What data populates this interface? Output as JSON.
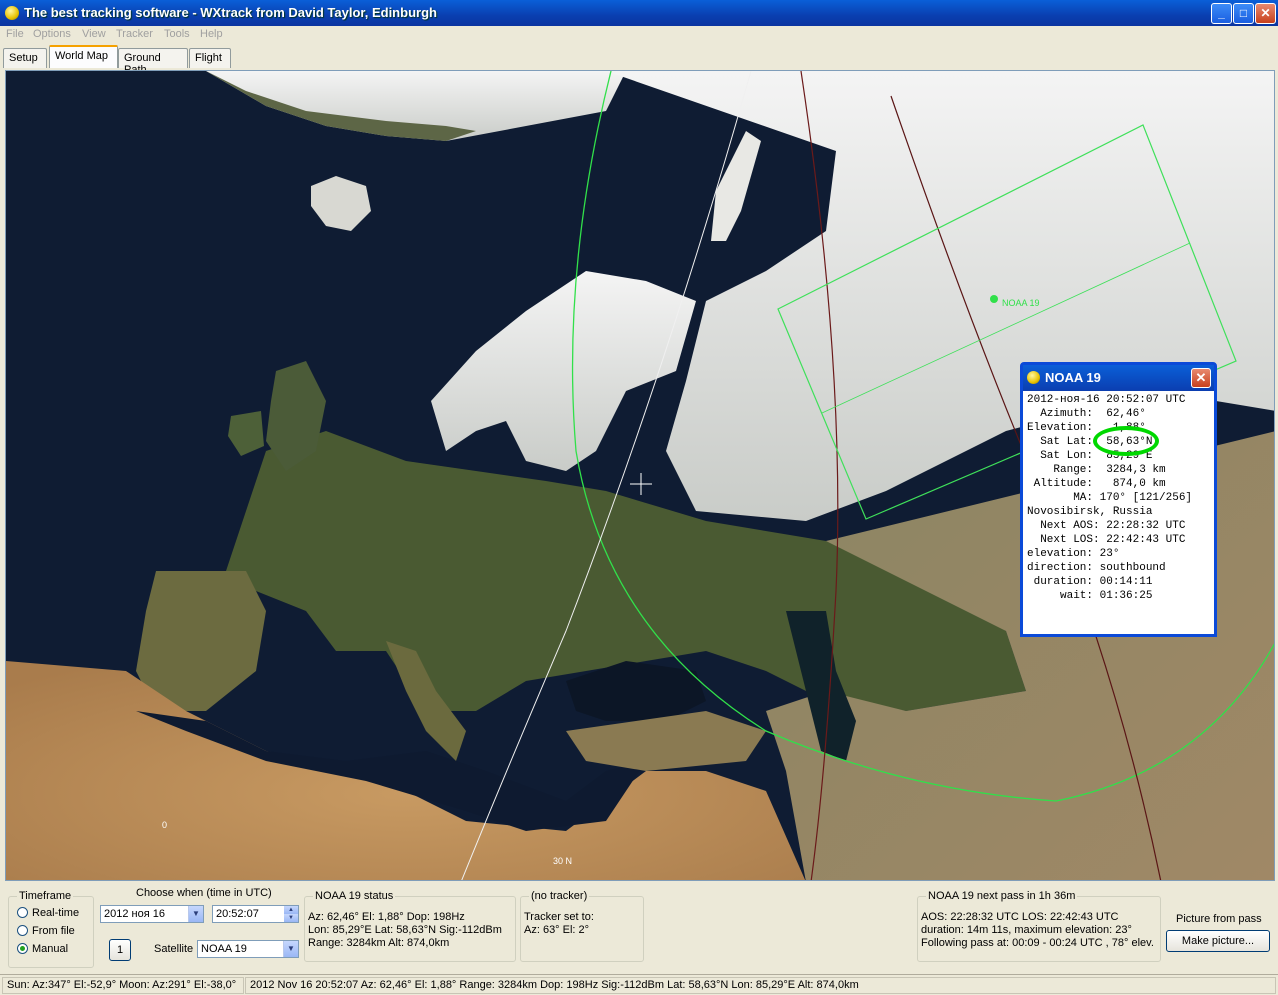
{
  "window": {
    "title": "The best tracking software - WXtrack from David Taylor, Edinburgh"
  },
  "menu": [
    "File",
    "Options",
    "View",
    "Tracker",
    "Tools",
    "Help"
  ],
  "tabs": [
    "Setup",
    "World Map",
    "Ground Path",
    "Flight"
  ],
  "map": {
    "labels": {
      "lat30": "30 N",
      "lon0": "0"
    },
    "sat_label": "NOAA 19"
  },
  "popup": {
    "title": "NOAA 19",
    "lines": [
      "2012-ноя-16 20:52:07 UTC",
      "",
      "  Azimuth:  62,46°",
      "Elevation:   1,88°",
      "  Sat Lat:  58,63°N",
      "  Sat Lon:  85,29°E",
      "    Range:  3284,3 km",
      " Altitude:   874,0 km",
      "       MA: 170° [121/256]",
      "Novosibirsk, Russia",
      "",
      "  Next AOS: 22:28:32 UTC",
      "  Next LOS: 22:42:43 UTC",
      "elevation: 23°",
      "direction: southbound",
      " duration: 00:14:11",
      "     wait: 01:36:25"
    ]
  },
  "timeframe": {
    "label": "Timeframe",
    "options": [
      "Real-time",
      "From file",
      "Manual"
    ],
    "selected": "Manual"
  },
  "choose": {
    "label": "Choose when (time in UTC)",
    "date": "2012 ноя 16",
    "time": "20:52:07",
    "step": "1",
    "satellite_label": "Satellite",
    "satellite": "NOAA 19"
  },
  "status": {
    "label": "NOAA 19 status",
    "line1": "Az: 62,46°  El: 1,88°  Dop: 198Hz",
    "line2": "Lon: 85,29°E  Lat: 58,63°N  Sig:-112dBm",
    "line3": "Range: 3284km  Alt: 874,0km"
  },
  "tracker": {
    "label": "(no tracker)",
    "line1": "Tracker set to:",
    "line2": "Az: 63°  El: 2°"
  },
  "nextpass": {
    "label": "NOAA 19 next pass in 1h 36m",
    "line1": "AOS: 22:28:32 UTC  LOS: 22:42:43 UTC",
    "line2": "duration: 14m 11s,  maximum elevation: 23°",
    "line3": "Following pass at: 00:09 - 00:24 UTC , 78° elev."
  },
  "picture": {
    "label": "Picture from pass",
    "button": "Make picture..."
  },
  "statusbar": {
    "left": "Sun: Az:347° El:-52,9°  Moon: Az:291° El:-38,0°",
    "right": "2012 Nov 16  20:52:07  Az: 62,46°  El: 1,88°  Range: 3284km  Dop: 198Hz  Sig:-112dBm  Lat: 58,63°N  Lon: 85,29°E  Alt: 874,0km"
  }
}
